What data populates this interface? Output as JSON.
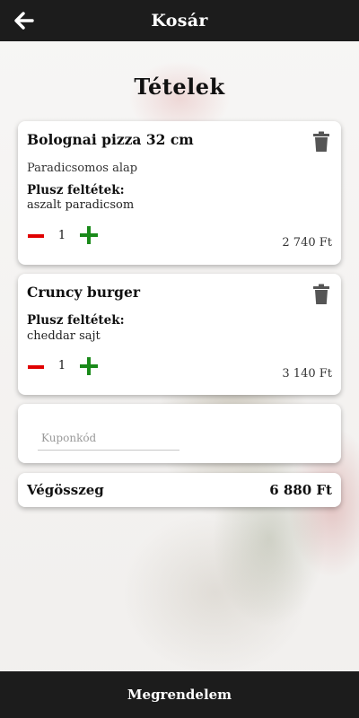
{
  "header": {
    "title": "Kosár",
    "back_icon": "arrow-left-icon"
  },
  "page": {
    "heading": "Tételek"
  },
  "items": [
    {
      "name": "Bolognai pizza 32 cm",
      "description": "Paradicsomos alap",
      "extras_label": "Plusz feltétek:",
      "extras": "aszalt paradicsom",
      "quantity": "1",
      "price": "2 740 Ft"
    },
    {
      "name": "Cruncy burger",
      "extras_label": "Plusz feltétek:",
      "extras": "cheddar sajt",
      "quantity": "1",
      "price": "3 140 Ft"
    }
  ],
  "coupon": {
    "placeholder": "Kuponkód",
    "value": ""
  },
  "total": {
    "label": "Végösszeg",
    "value": "6 880 Ft"
  },
  "footer": {
    "order_label": "Megrendelem"
  },
  "colors": {
    "bar": "#1c1c1c",
    "minus": "#e00000",
    "plus": "#1a8a1a",
    "trash": "#555555"
  }
}
